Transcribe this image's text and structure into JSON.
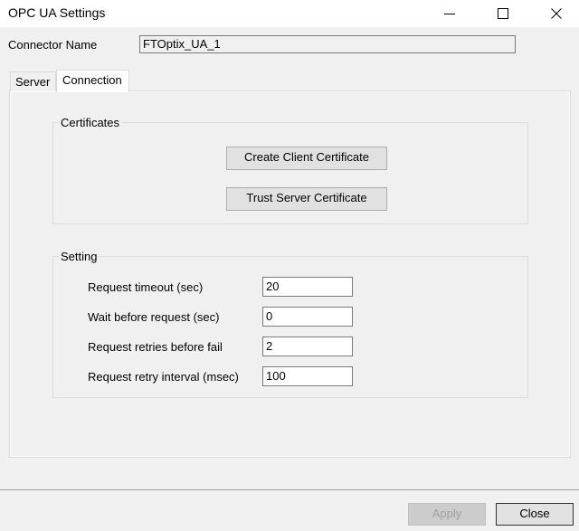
{
  "window": {
    "title": "OPC UA Settings"
  },
  "connector": {
    "label": "Connector Name",
    "value": "FTOptix_UA_1"
  },
  "tabs": [
    {
      "label": "Server"
    },
    {
      "label": "Connection"
    }
  ],
  "certificates": {
    "title": "Certificates",
    "create_button": "Create Client Certificate",
    "trust_button": "Trust Server Certificate"
  },
  "setting": {
    "title": "Setting",
    "fields": [
      {
        "label": "Request timeout (sec)",
        "value": "20"
      },
      {
        "label": "Wait before request (sec)",
        "value": "0"
      },
      {
        "label": "Request retries before fail",
        "value": "2"
      },
      {
        "label": "Request retry interval (msec)",
        "value": "100"
      }
    ]
  },
  "footer": {
    "apply_label": "Apply",
    "close_label": "Close"
  }
}
